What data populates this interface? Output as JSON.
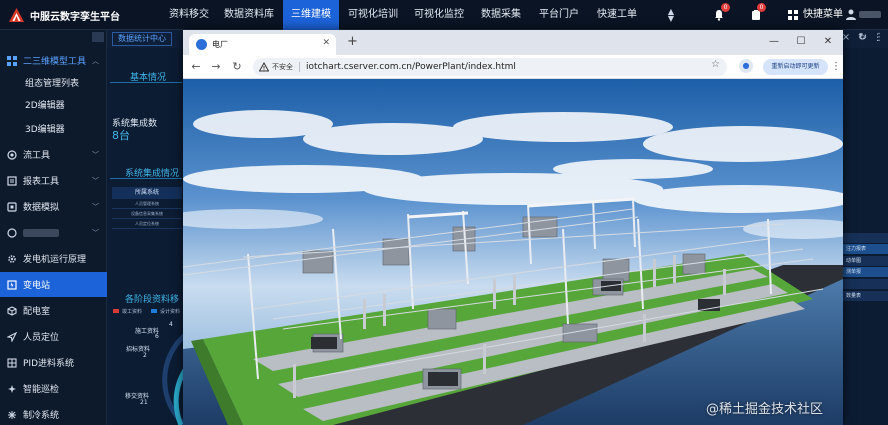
{
  "app": {
    "title": "中服云数字孪生平台"
  },
  "topnav": {
    "items": [
      {
        "label": "资料移交",
        "active": false
      },
      {
        "label": "数据资料库",
        "active": false
      },
      {
        "label": "三维建模",
        "active": true
      },
      {
        "label": "可视化培训",
        "active": false
      },
      {
        "label": "可视化监控",
        "active": false
      },
      {
        "label": "数据采集",
        "active": false
      },
      {
        "label": "平台门户",
        "active": false
      },
      {
        "label": "快速工单",
        "active": false
      }
    ],
    "bell_badge": "0",
    "message_badge": "0",
    "quick_menu": "快捷菜单"
  },
  "sidebar": {
    "items": [
      {
        "label": "二三维模型工具",
        "state": "open"
      },
      {
        "label": "组态管理列表",
        "state": "sub"
      },
      {
        "label": "2D编辑器",
        "state": "sub"
      },
      {
        "label": "3D编辑器",
        "state": "sub"
      },
      {
        "label": "流工具",
        "state": "collapsed"
      },
      {
        "label": "报表工具",
        "state": "collapsed"
      },
      {
        "label": "数据模拟",
        "state": "collapsed"
      },
      {
        "label": "",
        "state": "blurred"
      },
      {
        "label": "发电机运行原理",
        "state": "normal"
      },
      {
        "label": "变电站",
        "state": "active"
      },
      {
        "label": "配电室",
        "state": "normal"
      },
      {
        "label": "人员定位",
        "state": "normal"
      },
      {
        "label": "PID进料系统",
        "state": "normal"
      },
      {
        "label": "智能巡检",
        "state": "normal"
      },
      {
        "label": "制冷系统",
        "state": "normal"
      }
    ]
  },
  "dashboard": {
    "tab": "数据统计中心",
    "section_basic": "基本情况",
    "kpi_label": "系统集成数",
    "kpi_value": "8台",
    "section_integration": "系统集成情况",
    "table_head": "所属系统",
    "table_rows": [
      "人员管理系统",
      "设备信息采集系统",
      "人员定位系统"
    ],
    "section_stages": "各阶段资料移",
    "legend": [
      "竣工资料",
      "设计资料"
    ],
    "ring_labels": [
      "施工资料",
      "招标资料",
      "移交资料"
    ],
    "ring_numbers": [
      "4",
      "6",
      "2",
      "21"
    ],
    "right_tabs": [
      "",
      "注力报表",
      "动单图",
      "测单报",
      "",
      "数量表"
    ]
  },
  "browser": {
    "tab_title": "电厂",
    "insecure_label": "不安全",
    "url": "iotchart.cserver.com.cn/PowerPlant/index.html",
    "restart_label": "重新启动即可更新"
  },
  "watermark": "@稀土掘金技术社区",
  "colors": {
    "accent": "#1c62d8",
    "sky_top": "#1d5fa8",
    "grass": "#57a63a"
  }
}
